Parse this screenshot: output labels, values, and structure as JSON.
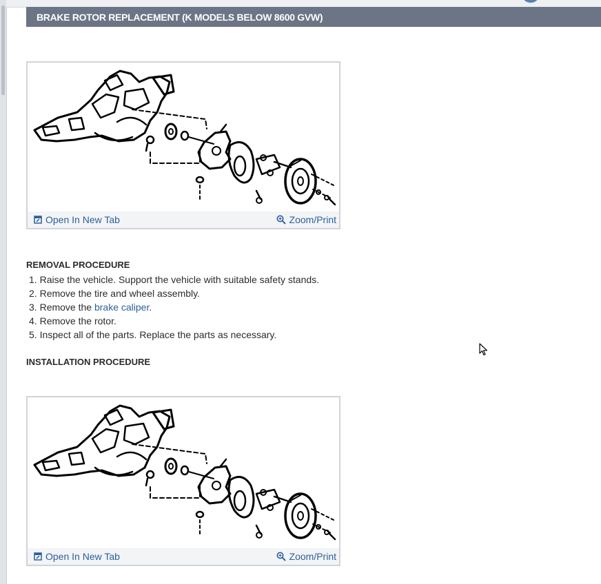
{
  "header": {
    "title": "BRAKE ROTOR REPLACEMENT (K MODELS BELOW 8600 GVW)"
  },
  "figures": [
    {
      "open_label": "Open In New Tab",
      "zoom_label": "Zoom/Print"
    },
    {
      "open_label": "Open In New Tab",
      "zoom_label": "Zoom/Print"
    }
  ],
  "removal": {
    "heading": "REMOVAL PROCEDURE",
    "steps": [
      {
        "num": "1.",
        "text": "Raise the vehicle. Support the vehicle with suitable safety stands."
      },
      {
        "num": "2.",
        "text": "Remove the tire and wheel assembly."
      },
      {
        "num": "3.",
        "prefix": "Remove the ",
        "link": "brake caliper",
        "suffix": "."
      },
      {
        "num": "4.",
        "text": "Remove the rotor."
      },
      {
        "num": "5.",
        "text": "Inspect all of the parts. Replace the parts as necessary."
      }
    ]
  },
  "installation": {
    "heading": "INSTALLATION PROCEDURE"
  },
  "colors": {
    "header_bg": "#6b7585",
    "link": "#2c5f9a",
    "figure_bar": "#f2f4f6"
  },
  "icons": {
    "open": "open-new-tab-icon",
    "zoom": "zoom-in-icon",
    "cursor": "mouse-cursor-icon"
  }
}
